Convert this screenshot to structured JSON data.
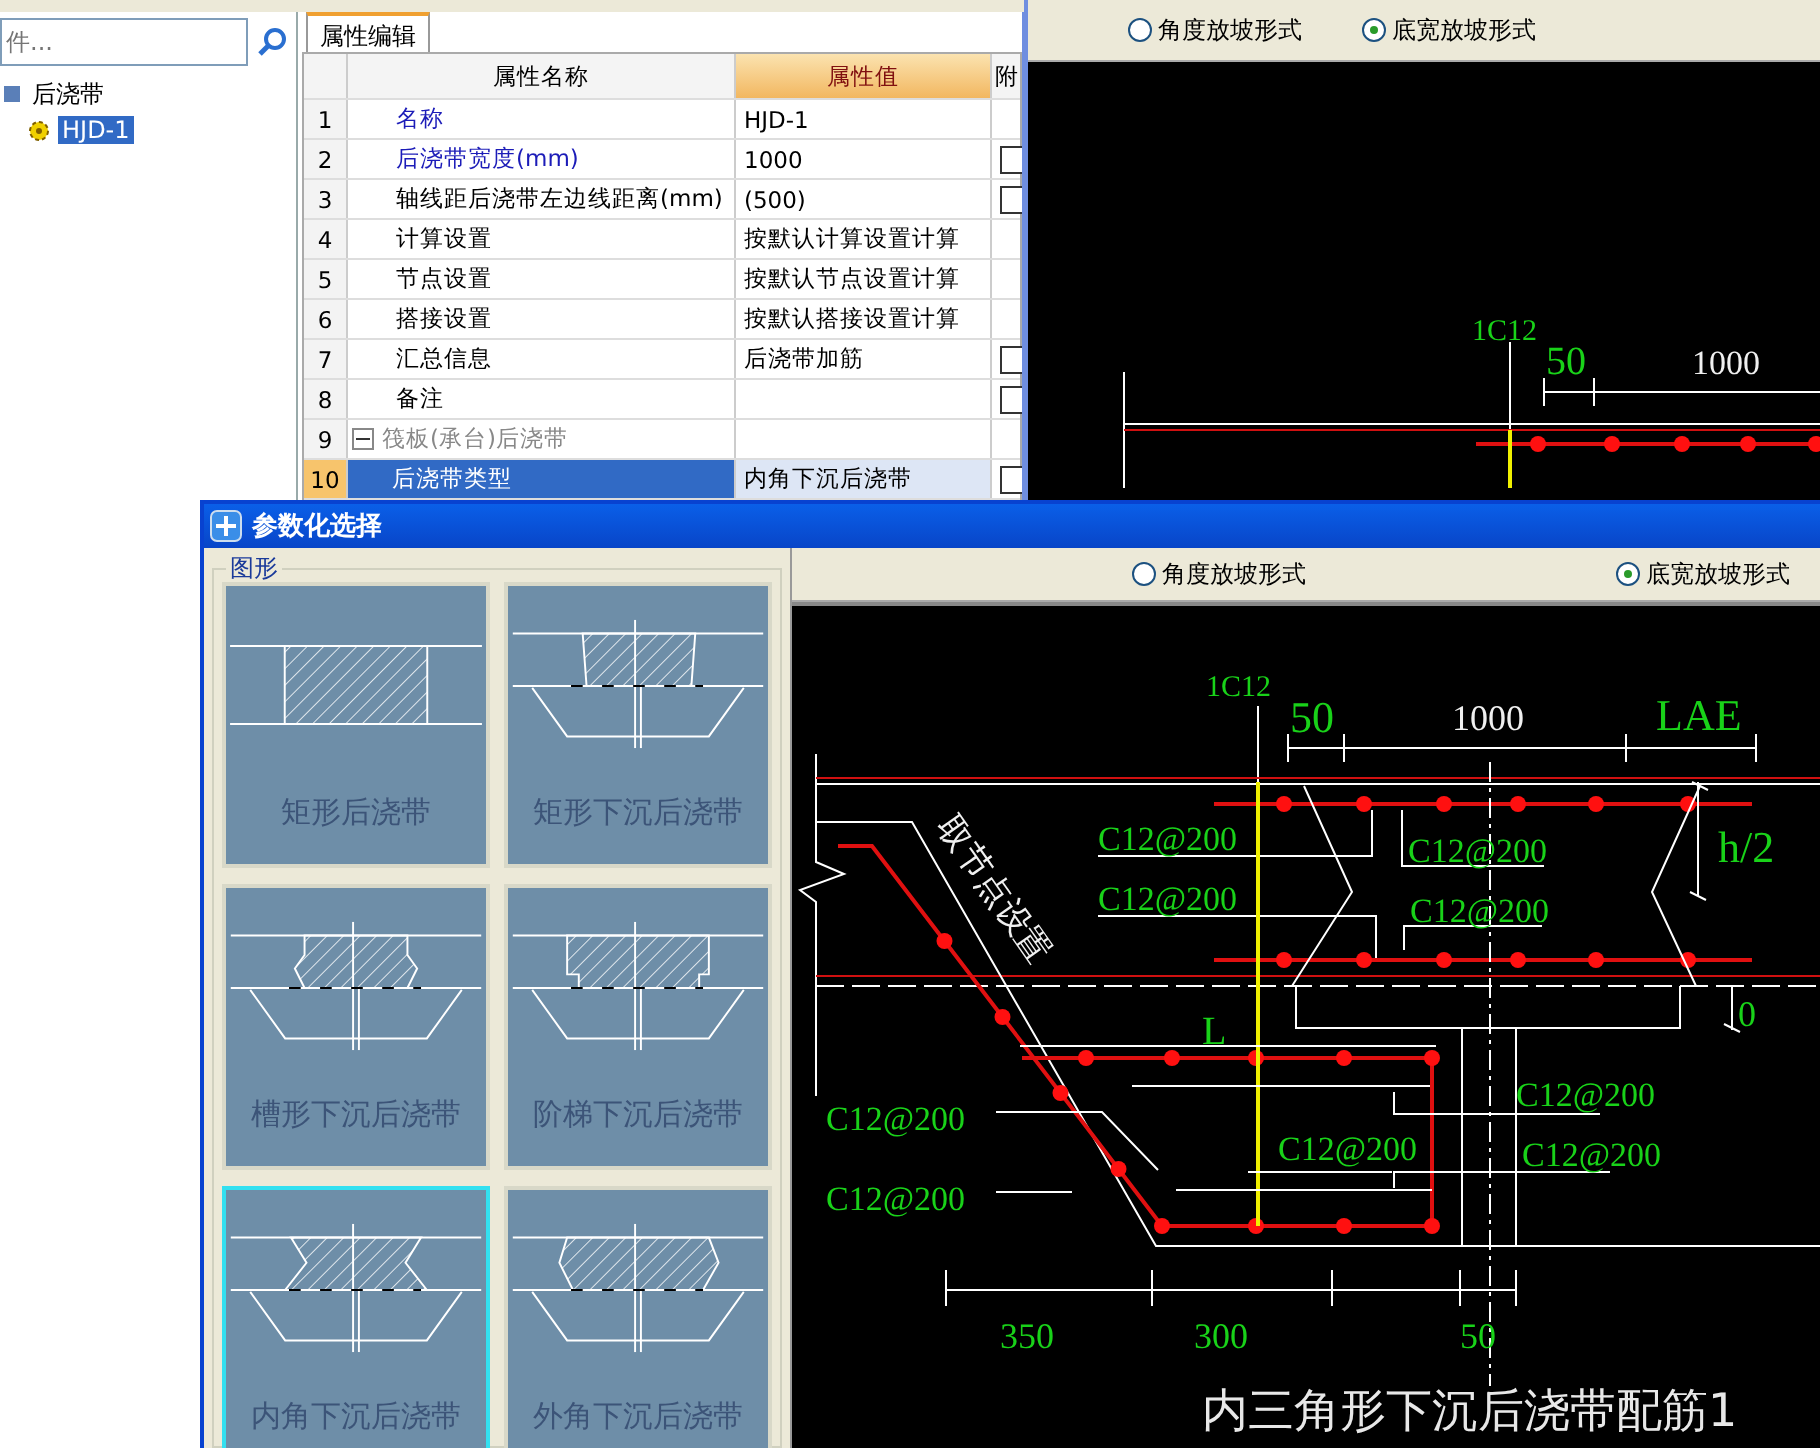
{
  "search": {
    "placeholder": "件..."
  },
  "tree": [
    {
      "label": "后浇带",
      "selected": false,
      "children": [
        {
          "label": "HJD-1",
          "selected": true
        }
      ]
    }
  ],
  "tabs": [
    {
      "label": "属性编辑",
      "selected": true
    }
  ],
  "grid": {
    "columns": [
      "属性名称",
      "属性值",
      "附"
    ],
    "rows": [
      {
        "kind": "field",
        "number": "1",
        "name": "名称",
        "value": "HJD-1",
        "color": "#1c1cb8",
        "has_box": false,
        "selected": false
      },
      {
        "kind": "field",
        "number": "2",
        "name": "后浇带宽度(mm)",
        "value": "1000",
        "color": "#1c1cb8",
        "has_box": true,
        "selected": false
      },
      {
        "kind": "field",
        "number": "3",
        "name": "轴线距后浇带左边线距离(mm)",
        "value": "(500)",
        "color": "#000000",
        "has_box": true,
        "selected": false
      },
      {
        "kind": "field",
        "number": "4",
        "name": "计算设置",
        "value": "按默认计算设置计算",
        "color": "#000000",
        "has_box": false,
        "selected": false
      },
      {
        "kind": "field",
        "number": "5",
        "name": "节点设置",
        "value": "按默认节点设置计算",
        "color": "#000000",
        "has_box": false,
        "selected": false
      },
      {
        "kind": "field",
        "number": "6",
        "name": "搭接设置",
        "value": "按默认搭接设置计算",
        "color": "#000000",
        "has_box": false,
        "selected": false
      },
      {
        "kind": "field",
        "number": "7",
        "name": "汇总信息",
        "value": "后浇带加筋",
        "color": "#000000",
        "has_box": true,
        "selected": false
      },
      {
        "kind": "field",
        "number": "8",
        "name": "备注",
        "value": "",
        "color": "#000000",
        "has_box": true,
        "selected": false
      },
      {
        "kind": "group",
        "number": "9",
        "name": "筏板(承台)后浇带",
        "expanded": true,
        "selected": false,
        "children": [
          {
            "kind": "field",
            "number": "10",
            "name": "后浇带类型",
            "value": "内角下沉后浇带",
            "has_box": true,
            "selected": true
          }
        ]
      }
    ]
  },
  "back_window": {
    "radios": [
      {
        "label": "角度放坡形式",
        "selected": false
      },
      {
        "label": "底宽放坡形式",
        "selected": true
      }
    ],
    "labels": [
      "1C12",
      "50",
      "1000"
    ]
  },
  "dialog": {
    "title": "参数化选择",
    "group_label": "图形",
    "tiles": [
      {
        "label": "矩形后浇带",
        "kind": "rect",
        "selected": false
      },
      {
        "label": "矩形下沉后浇带",
        "kind": "rect-sunk",
        "selected": false
      },
      {
        "label": "槽形下沉后浇带",
        "kind": "groove-sunk",
        "selected": false
      },
      {
        "label": "阶梯下沉后浇带",
        "kind": "step-sunk",
        "selected": false
      },
      {
        "label": "内角下沉后浇带",
        "kind": "inner-sunk",
        "selected": true
      },
      {
        "label": "外角下沉后浇带",
        "kind": "outer-sunk",
        "selected": false
      }
    ],
    "radios": [
      {
        "label": "角度放坡形式",
        "selected": false
      },
      {
        "label": "底宽放坡形式",
        "selected": true
      }
    ],
    "drawing": {
      "labels": [
        "1C12",
        "50",
        "1000",
        "LAE",
        "C12@200",
        "C12@200",
        "h/2",
        "C12@200",
        "C12@200",
        "取节点设置",
        "0",
        "L",
        "C12@200",
        "C12@200",
        "C12@200",
        "C12@200",
        "C12@200",
        "350",
        "300",
        "50"
      ],
      "caption": "内三角形下沉后浇带配筋1"
    }
  }
}
